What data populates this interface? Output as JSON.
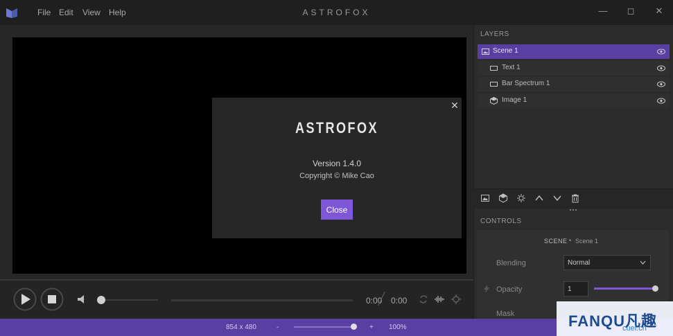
{
  "app": {
    "title": "ASTROFOX",
    "menu": [
      "File",
      "Edit",
      "View",
      "Help"
    ],
    "window_controls": [
      "minimize-icon",
      "maximize-icon",
      "close-icon"
    ]
  },
  "about_dialog": {
    "logo": "ASTROFOX",
    "version": "Version 1.4.0",
    "copyright": "Copyright © Mike Cao",
    "close_label": "Close"
  },
  "player": {
    "current_time": "0:00",
    "total_time": "0:00"
  },
  "layers": {
    "header": "LAYERS",
    "items": [
      {
        "label": "Scene 1",
        "icon": "image-icon",
        "selected": true
      },
      {
        "label": "Text 1",
        "icon": "rectangle-icon",
        "selected": false
      },
      {
        "label": "Bar Spectrum 1",
        "icon": "rectangle-icon",
        "selected": false
      },
      {
        "label": "Image 1",
        "icon": "cube-icon",
        "selected": false
      }
    ]
  },
  "controls": {
    "header": "CONTROLS",
    "section_label": "SCENE",
    "section_name": "Scene 1",
    "blending_label": "Blending",
    "blending_value": "Normal",
    "opacity_label": "Opacity",
    "opacity_value": "1",
    "mask_label": "Mask"
  },
  "status": {
    "resolution": "854 x 480",
    "zoom_minus": "-",
    "zoom_plus": "+",
    "zoom_value": "100%",
    "zoom_level": 1.0
  },
  "watermark": {
    "text": "FANQU凡趣",
    "sub": "cuel.cn"
  },
  "colors": {
    "accent": "#7e57d8",
    "statusbar": "#5a3fa3",
    "selected_layer": "#5a3fa3"
  }
}
